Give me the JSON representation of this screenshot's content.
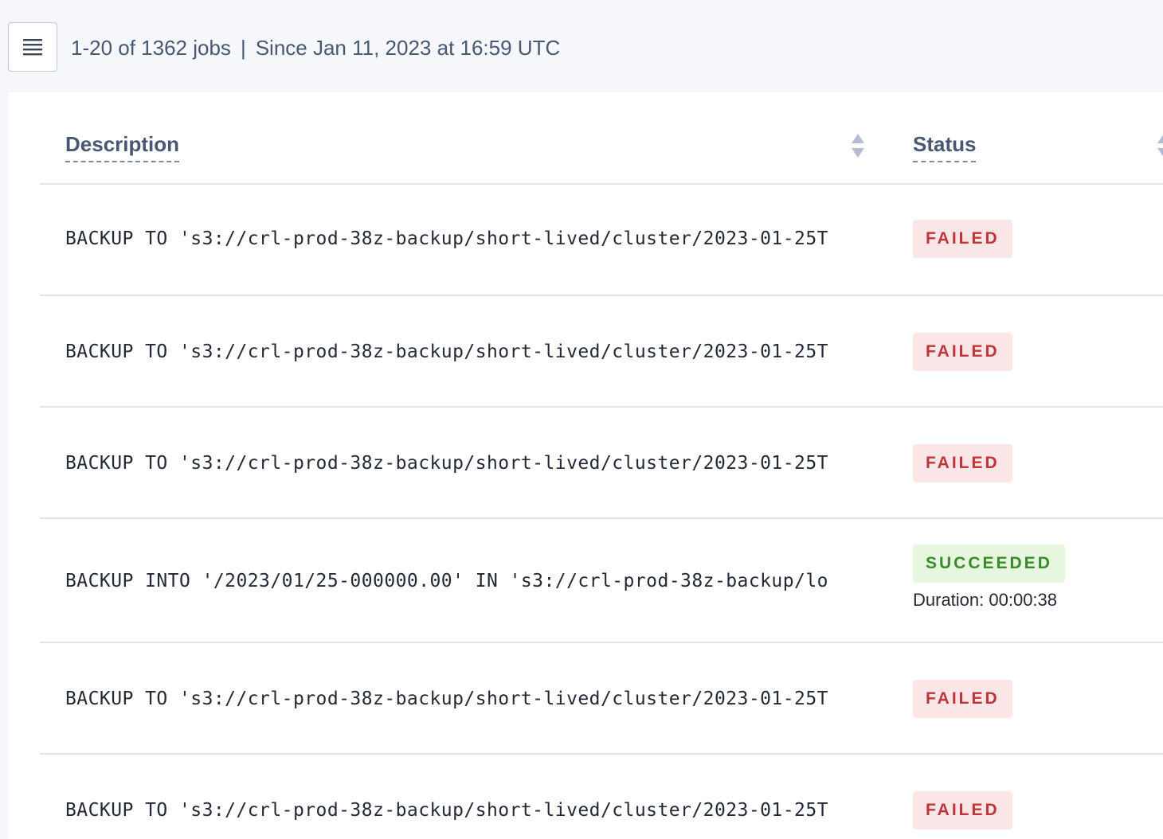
{
  "toolbar": {
    "columns_icon": "hamburger-menu-icon",
    "summary_count": "1-20 of 1362 jobs",
    "summary_separator": "|",
    "summary_since": "Since Jan 11, 2023 at 16:59 UTC"
  },
  "table": {
    "columns": [
      {
        "label": "Description"
      },
      {
        "label": "Status"
      }
    ],
    "rows": [
      {
        "description": "BACKUP TO 's3://crl-prod-38z-backup/short-lived/cluster/2023-01-25T",
        "status": "FAILED",
        "duration": ""
      },
      {
        "description": "BACKUP TO 's3://crl-prod-38z-backup/short-lived/cluster/2023-01-25T",
        "status": "FAILED",
        "duration": ""
      },
      {
        "description": "BACKUP TO 's3://crl-prod-38z-backup/short-lived/cluster/2023-01-25T",
        "status": "FAILED",
        "duration": ""
      },
      {
        "description": "BACKUP INTO '/2023/01/25-000000.00' IN 's3://crl-prod-38z-backup/lo",
        "status": "SUCCEEDED",
        "duration": "Duration: 00:00:38"
      },
      {
        "description": "BACKUP TO 's3://crl-prod-38z-backup/short-lived/cluster/2023-01-25T",
        "status": "FAILED",
        "duration": ""
      },
      {
        "description": "BACKUP TO 's3://crl-prod-38z-backup/short-lived/cluster/2023-01-25T",
        "status": "FAILED",
        "duration": ""
      }
    ]
  },
  "colors": {
    "failed_bg": "#fae6e6",
    "failed_text": "#c0343b",
    "succeeded_bg": "#e6f6df",
    "succeeded_text": "#3b8a2c",
    "header_text": "#475872",
    "page_bg": "#f5f7fa"
  }
}
